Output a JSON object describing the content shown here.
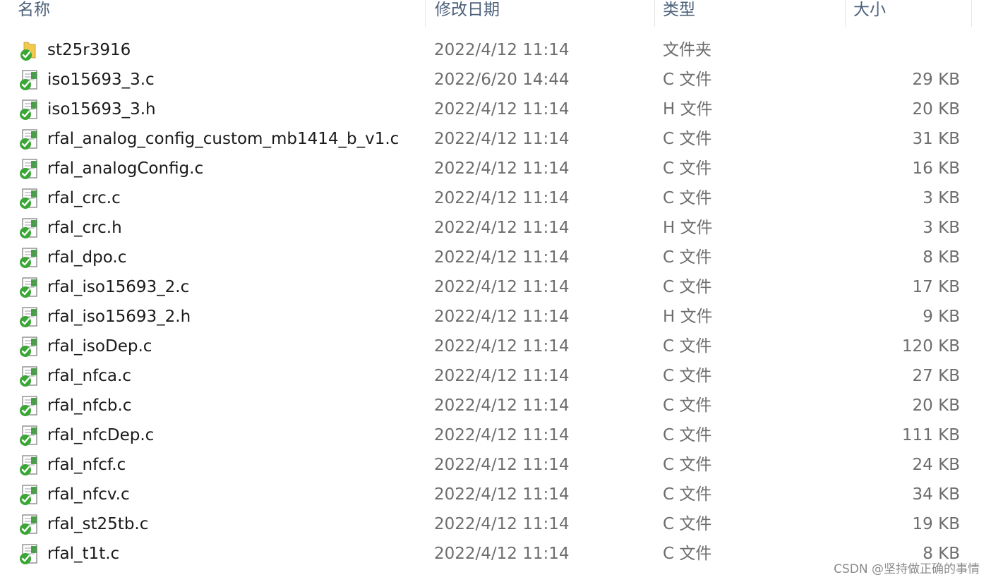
{
  "columns": {
    "name": "名称",
    "date": "修改日期",
    "type": "类型",
    "size": "大小"
  },
  "files": [
    {
      "name": "st25r3916",
      "date": "2022/4/12 11:14",
      "type": "文件夹",
      "size": "",
      "icon": "folder-synced-icon"
    },
    {
      "name": "iso15693_3.c",
      "date": "2022/6/20 14:44",
      "type": "C 文件",
      "size": "29 KB",
      "icon": "file-synced-icon"
    },
    {
      "name": "iso15693_3.h",
      "date": "2022/4/12 11:14",
      "type": "H 文件",
      "size": "20 KB",
      "icon": "file-synced-icon"
    },
    {
      "name": "rfal_analog_config_custom_mb1414_b_v1.c",
      "date": "2022/4/12 11:14",
      "type": "C 文件",
      "size": "31 KB",
      "icon": "file-synced-icon"
    },
    {
      "name": "rfal_analogConfig.c",
      "date": "2022/4/12 11:14",
      "type": "C 文件",
      "size": "16 KB",
      "icon": "file-synced-icon"
    },
    {
      "name": "rfal_crc.c",
      "date": "2022/4/12 11:14",
      "type": "C 文件",
      "size": "3 KB",
      "icon": "file-synced-icon"
    },
    {
      "name": "rfal_crc.h",
      "date": "2022/4/12 11:14",
      "type": "H 文件",
      "size": "3 KB",
      "icon": "file-synced-icon"
    },
    {
      "name": "rfal_dpo.c",
      "date": "2022/4/12 11:14",
      "type": "C 文件",
      "size": "8 KB",
      "icon": "file-synced-icon"
    },
    {
      "name": "rfal_iso15693_2.c",
      "date": "2022/4/12 11:14",
      "type": "C 文件",
      "size": "17 KB",
      "icon": "file-synced-icon"
    },
    {
      "name": "rfal_iso15693_2.h",
      "date": "2022/4/12 11:14",
      "type": "H 文件",
      "size": "9 KB",
      "icon": "file-synced-icon"
    },
    {
      "name": "rfal_isoDep.c",
      "date": "2022/4/12 11:14",
      "type": "C 文件",
      "size": "120 KB",
      "icon": "file-synced-icon"
    },
    {
      "name": "rfal_nfca.c",
      "date": "2022/4/12 11:14",
      "type": "C 文件",
      "size": "27 KB",
      "icon": "file-synced-icon"
    },
    {
      "name": "rfal_nfcb.c",
      "date": "2022/4/12 11:14",
      "type": "C 文件",
      "size": "20 KB",
      "icon": "file-synced-icon"
    },
    {
      "name": "rfal_nfcDep.c",
      "date": "2022/4/12 11:14",
      "type": "C 文件",
      "size": "111 KB",
      "icon": "file-synced-icon"
    },
    {
      "name": "rfal_nfcf.c",
      "date": "2022/4/12 11:14",
      "type": "C 文件",
      "size": "24 KB",
      "icon": "file-synced-icon"
    },
    {
      "name": "rfal_nfcv.c",
      "date": "2022/4/12 11:14",
      "type": "C 文件",
      "size": "34 KB",
      "icon": "file-synced-icon"
    },
    {
      "name": "rfal_st25tb.c",
      "date": "2022/4/12 11:14",
      "type": "C 文件",
      "size": "19 KB",
      "icon": "file-synced-icon"
    },
    {
      "name": "rfal_t1t.c",
      "date": "2022/4/12 11:14",
      "type": "C 文件",
      "size": "8 KB",
      "icon": "file-synced-icon"
    }
  ],
  "watermark": "CSDN @坚持做正确的事情",
  "colors": {
    "header_text": "#4c607a",
    "name_text": "#1a1a1a",
    "meta_text": "#6d6d6d",
    "sync_green": "#3aa636",
    "folder_yellow": "#f2c94c"
  }
}
